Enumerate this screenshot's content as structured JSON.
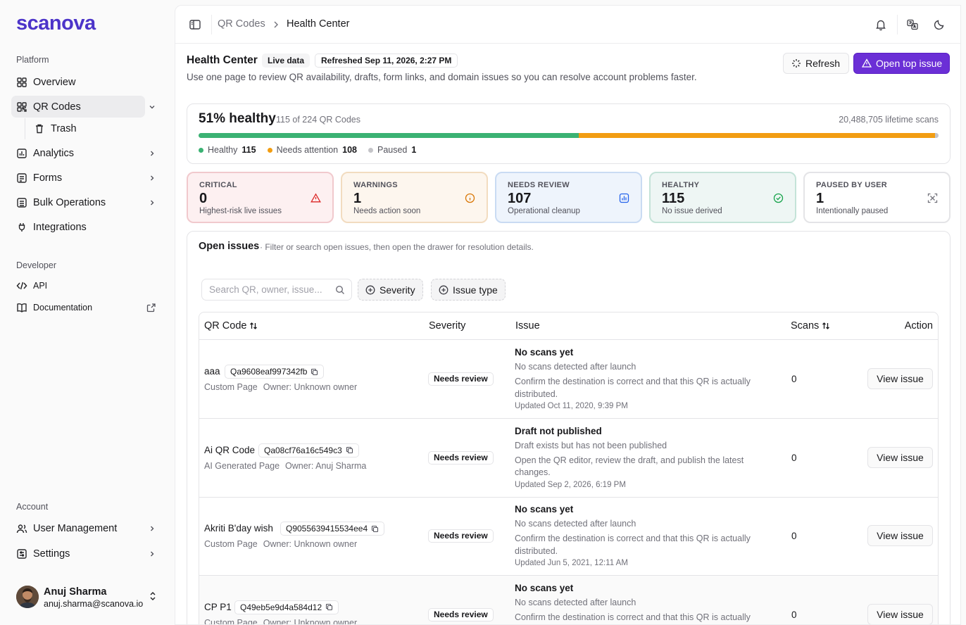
{
  "brand": {
    "logo_text": "scanova",
    "accent": "#4c34c9"
  },
  "sidebar": {
    "platform_label": "Platform",
    "items": [
      {
        "label": "Overview",
        "icon": "grid-icon"
      },
      {
        "label": "QR Codes",
        "icon": "qr-code-icon",
        "expanded": true,
        "active": true
      },
      {
        "label": "Trash",
        "icon": "trash-icon"
      },
      {
        "label": "Analytics",
        "icon": "chart-icon"
      },
      {
        "label": "Forms",
        "icon": "form-icon"
      },
      {
        "label": "Bulk Operations",
        "icon": "bulk-icon"
      },
      {
        "label": "Integrations",
        "icon": "plug-icon"
      }
    ],
    "developer_label": "Developer",
    "dev_items": [
      {
        "label": "API",
        "icon": "code-icon"
      },
      {
        "label": "Documentation",
        "icon": "book-icon"
      }
    ],
    "account_label": "Account",
    "account_items": [
      {
        "label": "User Management",
        "icon": "users-icon"
      },
      {
        "label": "Settings",
        "icon": "settings-icon"
      }
    ],
    "user": {
      "name": "Anuj Sharma",
      "email": "anuj.sharma@scanova.io"
    }
  },
  "topbar": {
    "breadcrumb": [
      "QR Codes",
      "Health Center"
    ]
  },
  "header": {
    "title": "Health Center",
    "live_badge": "Live data",
    "refreshed": "Refreshed Sep 11, 2026, 2:27 PM",
    "description": "Use one page to review QR availability, drafts, form links, and domain issues so you can resolve account problems faster.",
    "refresh_label": "Refresh",
    "open_top_label": "Open top issue"
  },
  "health": {
    "percent_label": "51% healthy",
    "of_label": "115 of 224 QR Codes",
    "lifetime_label": "20,488,705 lifetime scans",
    "segments": [
      {
        "name": "Healthy",
        "value": 115,
        "color": "#3bb273"
      },
      {
        "name": "Needs attention",
        "value": 108,
        "color": "#f29d12"
      },
      {
        "name": "Paused",
        "value": 1,
        "color": "#c4c4c8"
      }
    ],
    "total": 224
  },
  "stats": [
    {
      "label": "CRITICAL",
      "value": "0",
      "sub": "Highest-risk live issues",
      "icon": "alert-triangle-icon",
      "bg": "#fdf0f1",
      "border": "#f1c9cd",
      "icon_color": "#dc2626"
    },
    {
      "label": "WARNINGS",
      "value": "1",
      "sub": "Needs action soon",
      "icon": "info-circle-icon",
      "bg": "#fdf6ee",
      "border": "#f2dcc0",
      "icon_color": "#d97706"
    },
    {
      "label": "NEEDS REVIEW",
      "value": "107",
      "sub": "Operational cleanup",
      "icon": "chart-box-icon",
      "bg": "#eef4fc",
      "border": "#c9dbf3",
      "icon_color": "#2563eb"
    },
    {
      "label": "HEALTHY",
      "value": "115",
      "sub": "No issue derived",
      "icon": "check-circle-icon",
      "bg": "#eef6f4",
      "border": "#c4e3d8",
      "icon_color": "#16a34a"
    },
    {
      "label": "PAUSED BY USER",
      "value": "1",
      "sub": "Intentionally paused",
      "icon": "scan-icon",
      "bg": "#ffffff",
      "border": "#e4e4e7",
      "icon_color": "#71717a"
    }
  ],
  "issues": {
    "title": "Open issues",
    "subtitle": "· Filter or search open issues, then open the drawer for resolution details.",
    "search_placeholder": "Search QR, owner, issue...",
    "filters": [
      "Severity",
      "Issue type"
    ],
    "columns": [
      "QR Code",
      "Severity",
      "Issue",
      "Scans",
      "Action"
    ],
    "rows": [
      {
        "name": "aaa",
        "id": "Qa9608eaf997342fb",
        "type": "Custom Page",
        "owner": "Owner: Unknown owner",
        "severity": "Needs review",
        "issue": "No scans yet",
        "detail": "No scans detected after launch",
        "resolution": "Confirm the destination is correct and that this QR is actually distributed.",
        "updated": "Updated Oct 11, 2020, 9:39 PM",
        "scans": "0",
        "action": "View issue"
      },
      {
        "name": "Ai QR Code",
        "id": "Qa08cf76a16c549c3",
        "type": "AI Generated Page",
        "owner": "Owner: Anuj Sharma",
        "severity": "Needs review",
        "issue": "Draft not published",
        "detail": "Draft exists but has not been published",
        "resolution": "Open the QR editor, review the draft, and publish the latest changes.",
        "updated": "Updated Sep 2, 2026, 6:19 PM",
        "scans": "0",
        "action": "View issue"
      },
      {
        "name": "Akriti B'day wish",
        "id": "Q9055639415534ee4",
        "type": "Custom Page",
        "owner": "Owner: Unknown owner",
        "severity": "Needs review",
        "issue": "No scans yet",
        "detail": "No scans detected after launch",
        "resolution": "Confirm the destination is correct and that this QR is actually distributed.",
        "updated": "Updated Jun 5, 2021, 12:11 AM",
        "scans": "0",
        "action": "View issue"
      },
      {
        "name": "CP P1",
        "id": "Q49eb5e9d4a584d12",
        "type": "Custom Page",
        "owner": "Owner: Unknown owner",
        "severity": "Needs review",
        "issue": "No scans yet",
        "detail": "No scans detected after launch",
        "resolution": "Confirm the destination is correct and that this QR is actually distributed.",
        "updated": "",
        "scans": "0",
        "action": "View issue"
      }
    ]
  }
}
